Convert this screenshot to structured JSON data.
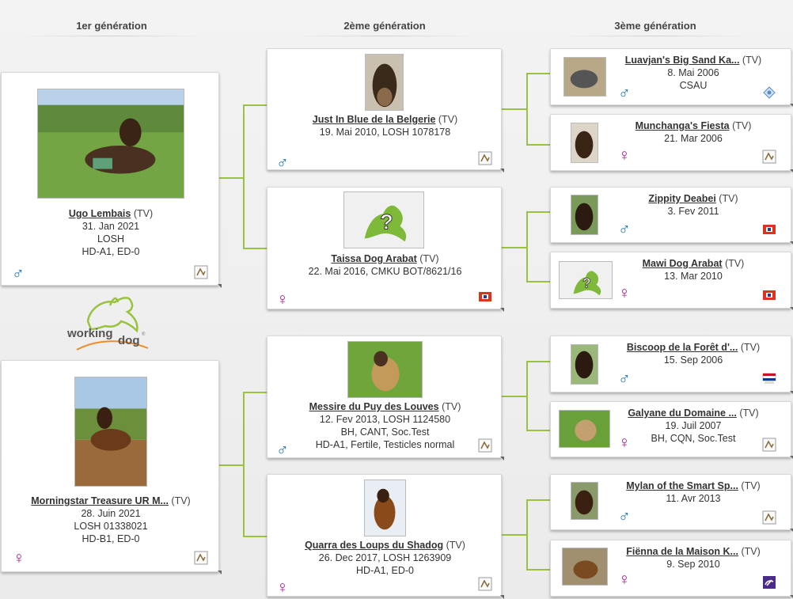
{
  "headers": {
    "gen1": "1er génération",
    "gen2": "2ème génération",
    "gen3": "3ème génération"
  },
  "logo": {
    "text": "working dog"
  },
  "colors": {
    "male": "#2275b5",
    "female": "#a3218f",
    "connector": "#9ac241"
  },
  "gen1": [
    {
      "name": "Ugo Lembais",
      "breed": "(TV)",
      "lines": [
        "31. Jan 2021",
        "LOSH",
        "HD-A1, ED-0"
      ],
      "sex": "♂",
      "club_icon": "losh-icon"
    },
    {
      "name": "Morningstar Treasure UR M...",
      "breed": "(TV)",
      "lines": [
        "28. Juin 2021",
        "LOSH 01338021",
        "HD-B1, ED-0"
      ],
      "sex": "♀",
      "club_icon": "losh-icon"
    }
  ],
  "gen2": [
    {
      "name": "Just In Blue de la Belgerie",
      "breed": "(TV)",
      "lines": [
        "19. Mai 2010, LOSH 1078178"
      ],
      "sex": "♂",
      "club_icon": "losh-icon"
    },
    {
      "name": "Taissa Dog Arabat",
      "breed": "(TV)",
      "lines": [
        "22. Mai 2016, CMKU BOT/8621/16"
      ],
      "sex": "♀",
      "club_icon": "cmku-icon"
    },
    {
      "name": "Messire du Puy des Louves",
      "breed": "(TV)",
      "lines": [
        "12. Fev 2013, LOSH 1124580",
        "BH, CANT, Soc.Test",
        "HD-A1, Fertile, Testicles normal"
      ],
      "sex": "♂",
      "club_icon": "losh-icon"
    },
    {
      "name": "Quarra des Loups du Shadog",
      "breed": "(TV)",
      "lines": [
        "26. Dec 2017, LOSH 1263909",
        "HD-A1, ED-0"
      ],
      "sex": "♀",
      "club_icon": "losh-icon"
    }
  ],
  "gen3": [
    {
      "name": "Luavjan's Big Sand Ka...",
      "breed": "(TV)",
      "lines": [
        "8. Mai 2006",
        "CSAU"
      ],
      "sex": "♂",
      "club_icon": "csau-icon"
    },
    {
      "name": "Munchanga's Fiesta",
      "breed": "(TV)",
      "lines": [
        "21. Mar 2006"
      ],
      "sex": "♀",
      "club_icon": "losh-icon"
    },
    {
      "name": "Zippity Deabei",
      "breed": "(TV)",
      "lines": [
        "3. Fev 2011"
      ],
      "sex": "♂",
      "club_icon": "cmku-icon"
    },
    {
      "name": "Mawi Dog Arabat",
      "breed": "(TV)",
      "lines": [
        "13. Mar 2010"
      ],
      "sex": "♀",
      "club_icon": "cmku-icon"
    },
    {
      "name": "Biscoop de la Forêt d'...",
      "breed": "(TV)",
      "lines": [
        "15. Sep 2006"
      ],
      "sex": "♂",
      "club_icon": "kennel-club-icon"
    },
    {
      "name": "Galyane du Domaine ...",
      "breed": "(TV)",
      "lines": [
        "19. Juil 2007",
        "BH, CQN, Soc.Test"
      ],
      "sex": "♀",
      "club_icon": "losh-icon"
    },
    {
      "name": "Mylan of the Smart Sp...",
      "breed": "(TV)",
      "lines": [
        "11. Avr 2013"
      ],
      "sex": "♂",
      "club_icon": "losh-icon"
    },
    {
      "name": "Fiënna de la Maison K...",
      "breed": "(TV)",
      "lines": [
        "9. Sep 2010"
      ],
      "sex": "♀",
      "club_icon": "dog-club-icon"
    }
  ]
}
